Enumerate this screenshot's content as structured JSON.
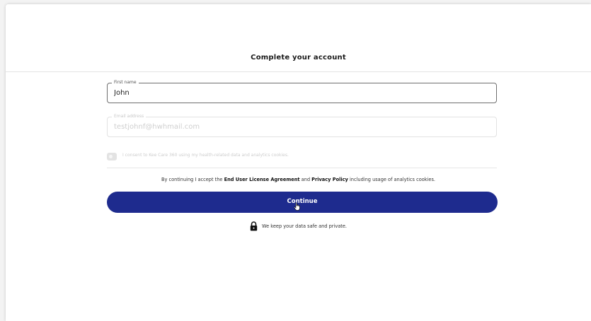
{
  "header": {
    "title": "Complete your account"
  },
  "form": {
    "first_name": {
      "label": "First name",
      "value": "John"
    },
    "email": {
      "label": "Email address",
      "value": "testjohnf@hwhmail.com"
    },
    "consent": {
      "text": "I consent to Kee Care 360 using my health-related data and analytics cookies."
    }
  },
  "legal": {
    "prefix": "By continuing I accept the ",
    "eula": "End User License Agreement",
    "and": " and ",
    "privacy": "Privacy Policy",
    "suffix": " including usage of analytics cookies."
  },
  "continue_button": {
    "label": "Continue",
    "color": "#1e2b8e"
  },
  "security_note": {
    "icon": "lock-icon",
    "text": "We keep your data safe and private."
  }
}
